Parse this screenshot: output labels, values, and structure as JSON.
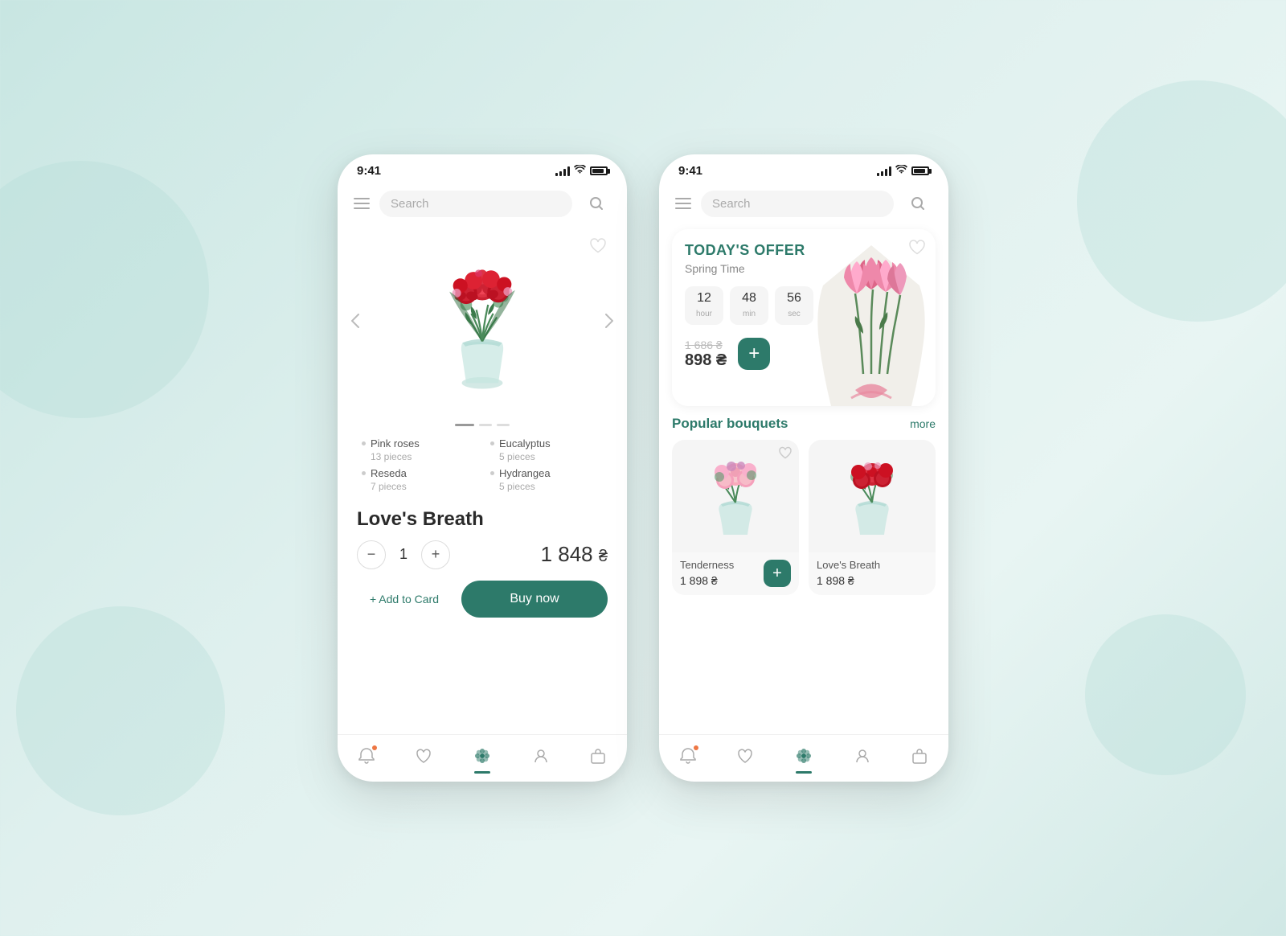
{
  "background": {
    "color": "#c8e6e2"
  },
  "phone1": {
    "status_bar": {
      "time": "9:41",
      "signal": "●●●●",
      "wifi": "wifi",
      "battery": "battery"
    },
    "search": {
      "placeholder": "Search",
      "icon": "search-icon"
    },
    "product": {
      "name": "Love's Breath",
      "quantity": "1",
      "price": "1 848 ₴",
      "price_currency": "₴"
    },
    "ingredients": [
      {
        "name": "Pink roses",
        "count": "13 pieces"
      },
      {
        "name": "Eucalyptus",
        "count": "5 pieces"
      },
      {
        "name": "Reseda",
        "count": "7 pieces"
      },
      {
        "name": "Hydrangea",
        "count": "5 pieces"
      }
    ],
    "buttons": {
      "add_to_card": "+ Add to Card",
      "buy_now": "Buy now"
    },
    "nav": {
      "items": [
        "bell",
        "heart",
        "flower",
        "person",
        "bag"
      ]
    }
  },
  "phone2": {
    "status_bar": {
      "time": "9:41"
    },
    "search": {
      "placeholder": "Search"
    },
    "offer": {
      "title": "TODAY'S OFFER",
      "subtitle": "Spring Time",
      "countdown": {
        "hour": "12",
        "hour_label": "hour",
        "min": "48",
        "min_label": "min",
        "sec": "56",
        "sec_label": "sec"
      },
      "old_price": "1 686 ₴",
      "new_price": "898 ₴",
      "add_btn": "+"
    },
    "popular": {
      "title": "Popular bouquets",
      "more": "more",
      "bouquets": [
        {
          "name": "Tenderness",
          "price": "1 898 ₴"
        },
        {
          "name": "Love's Breath",
          "price": "1 898 ₴"
        }
      ]
    },
    "nav": {
      "items": [
        "bell",
        "heart",
        "flower",
        "person",
        "bag"
      ]
    }
  }
}
